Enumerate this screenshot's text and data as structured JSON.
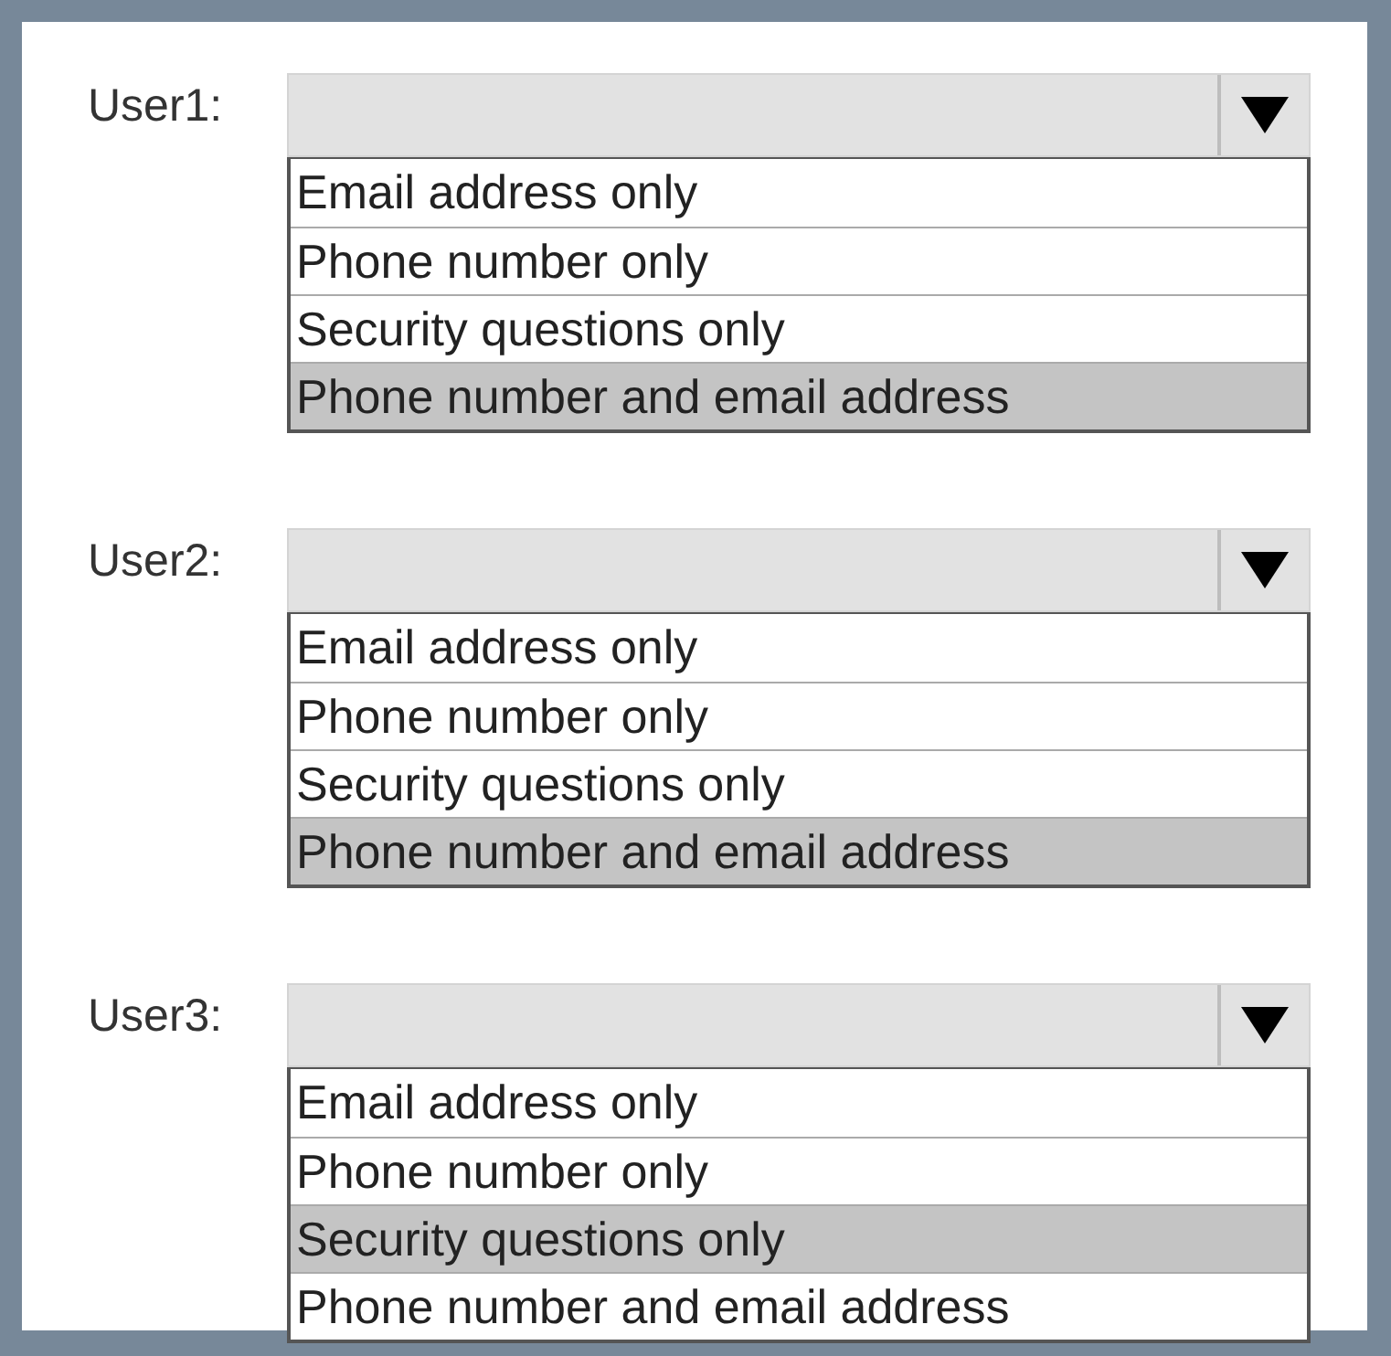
{
  "dropdowns": [
    {
      "label": "User1:",
      "options": [
        {
          "text": "Email address only",
          "selected": false
        },
        {
          "text": "Phone number only",
          "selected": false
        },
        {
          "text": "Security questions only",
          "selected": false
        },
        {
          "text": "Phone number and email address",
          "selected": true
        }
      ]
    },
    {
      "label": "User2:",
      "options": [
        {
          "text": "Email address only",
          "selected": false
        },
        {
          "text": "Phone number only",
          "selected": false
        },
        {
          "text": "Security questions only",
          "selected": false
        },
        {
          "text": "Phone number and email address",
          "selected": true
        }
      ]
    },
    {
      "label": "User3:",
      "options": [
        {
          "text": "Email address only",
          "selected": false
        },
        {
          "text": "Phone number only",
          "selected": false
        },
        {
          "text": "Security questions only",
          "selected": true
        },
        {
          "text": "Phone number and email address",
          "selected": false
        }
      ]
    }
  ]
}
